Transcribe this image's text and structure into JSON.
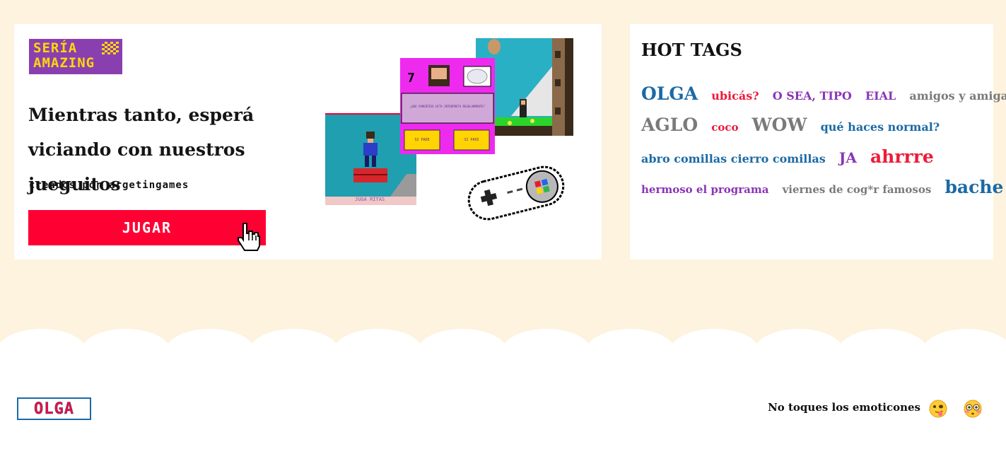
{
  "promo": {
    "logo_line1": "SERÍA",
    "logo_line2": "AMAZING",
    "title": "Mientras tanto, esperá viciando con nuestros jueguitos",
    "subtitle": "creados por argetingames",
    "play_label": "JUGAR",
    "shots": {
      "a_caption": "JUGA RITAS",
      "b_question": "¿QUE PAREBTESE HITA INTERPRETA REGULARMENTE?",
      "b_option_yes": "SI PADE",
      "b_option_no": "SI PAHI",
      "b_counter": "7"
    }
  },
  "hot_tags": {
    "title": "HOT TAGS",
    "rows": [
      [
        {
          "label": "OLGA",
          "color": "blue",
          "size": 25
        },
        {
          "label": "ubicás?",
          "color": "red",
          "size": 16
        },
        {
          "label": "O SEA, TIPO",
          "color": "purple",
          "size": 16
        },
        {
          "label": "EIAL",
          "color": "purple",
          "size": 16
        },
        {
          "label": "amigos y amigas",
          "color": "gray",
          "size": 16
        }
      ],
      [
        {
          "label": "AGLO",
          "color": "gray",
          "size": 25
        },
        {
          "label": "coco",
          "color": "red",
          "size": 15
        },
        {
          "label": "WOW",
          "color": "gray",
          "size": 25
        },
        {
          "label": "qué haces normal?",
          "color": "blue",
          "size": 16
        }
      ],
      [
        {
          "label": "abro comillas cierro comillas",
          "color": "blue",
          "size": 16
        },
        {
          "label": "JA",
          "color": "purple",
          "size": 20
        },
        {
          "label": "ahrrre",
          "color": "red",
          "size": 25
        }
      ],
      [
        {
          "label": "hermoso el programa",
          "color": "purple",
          "size": 15
        },
        {
          "label": "viernes de cog*r famosos",
          "color": "gray",
          "size": 15
        },
        {
          "label": "bache",
          "color": "blue",
          "size": 25
        }
      ]
    ]
  },
  "footer": {
    "logo": "OLGA",
    "emoticons_label": "No toques los emoticones",
    "emojis": [
      "face-with-tongue-icon",
      "flushed-face-icon"
    ]
  },
  "colors": {
    "background": "#fdf3de",
    "accent_red": "#ff0033",
    "tag_blue": "#1b6aa6",
    "tag_red": "#ee1a3a",
    "tag_purple": "#8a35b5",
    "tag_gray": "#7a7a7a"
  }
}
